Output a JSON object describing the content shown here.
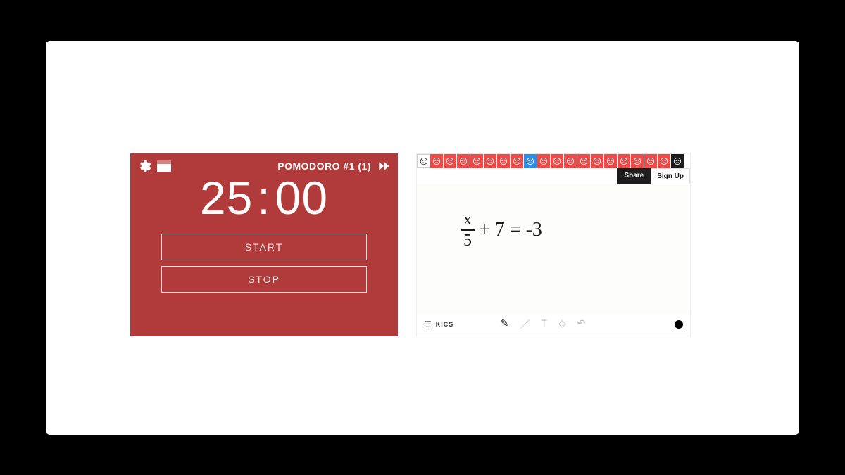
{
  "pomodoro": {
    "title": "POMODORO #1 (1)",
    "minutes": "25",
    "seconds": "00",
    "start_label": "START",
    "stop_label": "STOP",
    "bg_color": "#b13a3a"
  },
  "whiteboard": {
    "share_label": "Share",
    "signup_label": "Sign Up",
    "board_label": "KICS",
    "equation": {
      "numerator": "x",
      "denominator": "5",
      "rest": "+ 7 = -3"
    },
    "avatars": [
      {
        "color": "white"
      },
      {
        "color": "red"
      },
      {
        "color": "red"
      },
      {
        "color": "red"
      },
      {
        "color": "red"
      },
      {
        "color": "red"
      },
      {
        "color": "red"
      },
      {
        "color": "red"
      },
      {
        "color": "blue"
      },
      {
        "color": "red"
      },
      {
        "color": "red"
      },
      {
        "color": "red"
      },
      {
        "color": "red"
      },
      {
        "color": "red"
      },
      {
        "color": "red"
      },
      {
        "color": "red"
      },
      {
        "color": "red"
      },
      {
        "color": "red"
      },
      {
        "color": "red"
      },
      {
        "color": "black"
      }
    ],
    "tools": [
      "pencil",
      "line",
      "text",
      "erase",
      "undo"
    ],
    "active_tool": "pencil",
    "current_color": "#000000"
  }
}
